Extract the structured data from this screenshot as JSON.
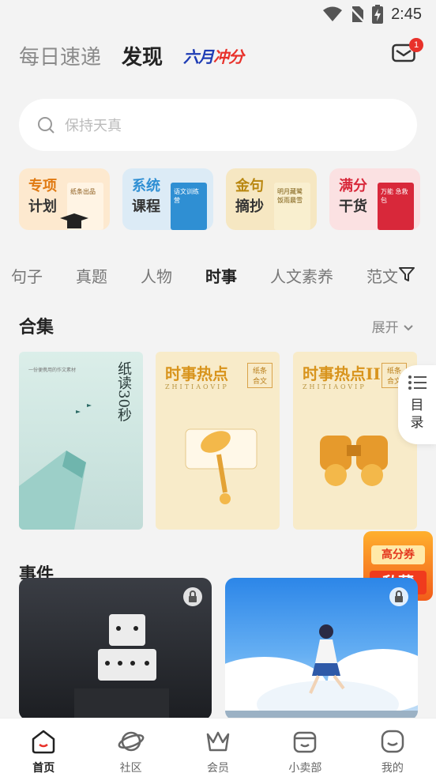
{
  "status_bar": {
    "time": "2:45"
  },
  "header": {
    "tabs": [
      {
        "label": "每日速递",
        "active": false
      },
      {
        "label": "发现",
        "active": true
      }
    ],
    "promo_part1": "六月",
    "promo_part2": "冲分",
    "mail_badge": "1"
  },
  "search": {
    "placeholder": "保持天真"
  },
  "quick_entries": [
    {
      "line1": "专项",
      "line2": "计划",
      "book_text": "纸条出品",
      "accent": "#e07a12"
    },
    {
      "line1": "系统",
      "line2": "课程",
      "book_text": "语文训练营",
      "accent": "#2f8fd3"
    },
    {
      "line1": "金句",
      "line2": "摘抄",
      "book_text": "明月藏鹭 饭雨晨雪",
      "accent": "#b98710"
    },
    {
      "line1": "满分",
      "line2": "干货",
      "book_text": "万能 急救包",
      "accent": "#d8283a"
    }
  ],
  "categories": [
    {
      "label": "句子",
      "active": false
    },
    {
      "label": "真题",
      "active": false
    },
    {
      "label": "人物",
      "active": false
    },
    {
      "label": "时事",
      "active": true
    },
    {
      "label": "人文素养",
      "active": false
    },
    {
      "label": "范文",
      "active": false
    }
  ],
  "collections": {
    "title": "合集",
    "expand_label": "展开",
    "items": [
      {
        "subtitle": "一份便携用的作文素材",
        "title_vertical": "纸读30秒"
      },
      {
        "title": "时事热点",
        "tag": "纸条 合文",
        "pinyin": "ZHITIAOVIP"
      },
      {
        "title": "时事热点II",
        "tag": "纸条 合文",
        "pinyin": "ZHITIAOVIP"
      }
    ]
  },
  "toc": {
    "label1": "目",
    "label2": "录"
  },
  "coupon": {
    "line1": "高分券",
    "line2": "私藏"
  },
  "events": {
    "title": "事件"
  },
  "tabbar": [
    {
      "label": "首页",
      "icon": "home-face-icon",
      "active": true
    },
    {
      "label": "社区",
      "icon": "planet-icon",
      "active": false
    },
    {
      "label": "会员",
      "icon": "crown-icon",
      "active": false
    },
    {
      "label": "小卖部",
      "icon": "shop-icon",
      "active": false
    },
    {
      "label": "我的",
      "icon": "smile-face-icon",
      "active": false
    }
  ],
  "colors": {
    "accent_red": "#e8312a",
    "background": "#f3f3f3"
  }
}
